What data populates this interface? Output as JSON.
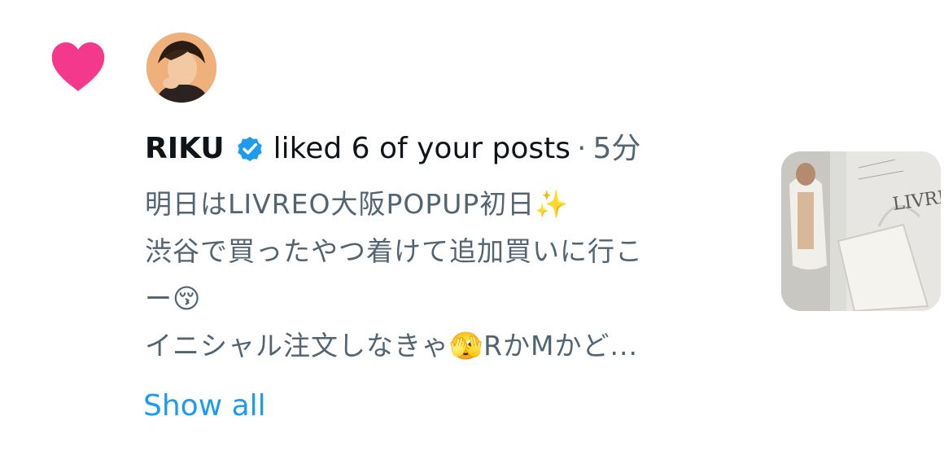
{
  "notification": {
    "username": "RIKU",
    "action": "liked 6 of your posts",
    "separator": "·",
    "time": "5分",
    "post_lines": [
      "明日はLIVREO大阪POPUP初日✨",
      "渋谷で買ったやつ着けて追加買いに行こ",
      "ー😚",
      "イニシャル注文しなきゃ🫣RかMかど..."
    ],
    "show_all": "Show all",
    "thumbnail_text": "LIVREO"
  },
  "colors": {
    "heart": "#f4398c",
    "verified": "#1d9bf0",
    "link": "#1d9bf0",
    "secondary_text": "#536471"
  },
  "icons": {
    "heart": "heart-icon",
    "verified": "verified-badge-icon"
  }
}
